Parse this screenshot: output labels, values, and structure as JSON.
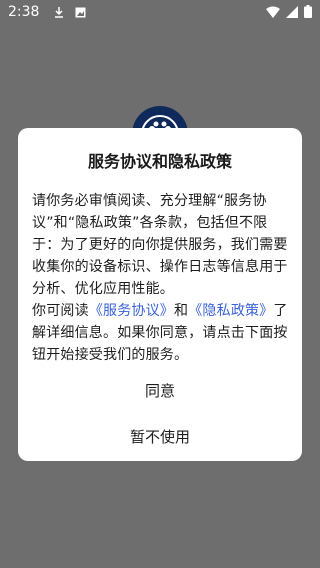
{
  "status_bar": {
    "time": "2:38",
    "left_icons": [
      "download-icon",
      "photo-icon"
    ],
    "right_icons": [
      "wifi-icon",
      "signal-icon",
      "battery-icon"
    ]
  },
  "dialog": {
    "title": "服务协议和隐私政策",
    "body_part1": "请你务必审慎阅读、充分理解“服务协议”和“隐私政策”各条款，包括但不限于：为了更好的向你提供服务，我们需要收集你的设备标识、操作日志等信息用于分析、优化应用性能。",
    "body_part2": "你可阅读",
    "link_service": "《服务协议》",
    "body_and": "和",
    "link_privacy": "《隐私政策》",
    "body_part3": "了解详细信息。如果你同意，请点击下面按钮开始接受我们的服务。",
    "agree_label": "同意",
    "decline_label": "暂不使用"
  },
  "colors": {
    "backdrop": "#6e6e6e",
    "link": "#3a63d6",
    "logo": "#0f2a5a"
  }
}
